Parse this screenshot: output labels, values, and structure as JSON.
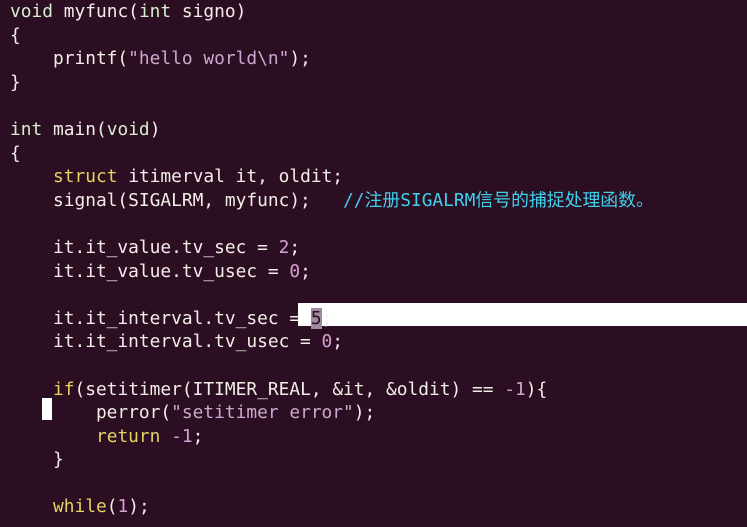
{
  "colors": {
    "background": "#2c0e22",
    "text": "#f2eee8",
    "type_keyword": "#d8efcf",
    "control_keyword": "#e6d164",
    "string": "#c9a9cf",
    "number": "#d5a0d2",
    "comment": "#3fd0ec"
  },
  "lines": [
    [
      {
        "t": "void",
        "c": "kw"
      },
      {
        "t": " myfunc("
      },
      {
        "t": "int",
        "c": "kw"
      },
      {
        "t": " signo)"
      }
    ],
    [
      {
        "t": "{"
      }
    ],
    [
      {
        "t": "    printf("
      },
      {
        "t": "\"hello world\\n\"",
        "c": "str"
      },
      {
        "t": ");"
      }
    ],
    [
      {
        "t": "}"
      }
    ],
    [
      {
        "t": ""
      }
    ],
    [
      {
        "t": "int",
        "c": "kw"
      },
      {
        "t": " main("
      },
      {
        "t": "void",
        "c": "kw"
      },
      {
        "t": ")"
      }
    ],
    [
      {
        "t": "{"
      }
    ],
    [
      {
        "t": "    "
      },
      {
        "t": "struct",
        "c": "kw2"
      },
      {
        "t": " itimerval it, oldit;"
      }
    ],
    [
      {
        "t": "    signal(SIGALRM, myfunc);   "
      },
      {
        "t": "//注册SIGALRM信号的捕捉处理函数。",
        "c": "cmt"
      }
    ],
    [
      {
        "t": ""
      }
    ],
    [
      {
        "t": "    it.it_value.tv_sec = "
      },
      {
        "t": "2",
        "c": "num"
      },
      {
        "t": ";"
      }
    ],
    [
      {
        "t": "    it.it_value.tv_usec = "
      },
      {
        "t": "0",
        "c": "num"
      },
      {
        "t": ";"
      }
    ],
    [
      {
        "t": ""
      }
    ],
    [
      {
        "t": "    it.it_interval.tv_sec = "
      },
      {
        "t": "5",
        "c": "cur-num"
      },
      {
        "t": ";"
      }
    ],
    [
      {
        "t": "    it.it_interval.tv_usec = "
      },
      {
        "t": "0",
        "c": "num"
      },
      {
        "t": ";"
      }
    ],
    [
      {
        "t": ""
      }
    ],
    [
      {
        "t": "    "
      },
      {
        "t": "if",
        "c": "kw2"
      },
      {
        "t": "(setitimer(ITIMER_REAL, &it, &oldit) == "
      },
      {
        "t": "-1",
        "c": "num"
      },
      {
        "t": "){"
      }
    ],
    [
      {
        "t": "        perror("
      },
      {
        "t": "\"setitimer error\"",
        "c": "str"
      },
      {
        "t": ");"
      }
    ],
    [
      {
        "t": "        "
      },
      {
        "t": "return",
        "c": "kw2"
      },
      {
        "t": " "
      },
      {
        "t": "-1",
        "c": "num"
      },
      {
        "t": ";"
      }
    ],
    [
      {
        "t": "    }"
      }
    ],
    [
      {
        "t": ""
      }
    ],
    [
      {
        "t": "    "
      },
      {
        "t": "while",
        "c": "kw2"
      },
      {
        "t": "("
      },
      {
        "t": "1",
        "c": "num"
      },
      {
        "t": ");"
      }
    ]
  ]
}
